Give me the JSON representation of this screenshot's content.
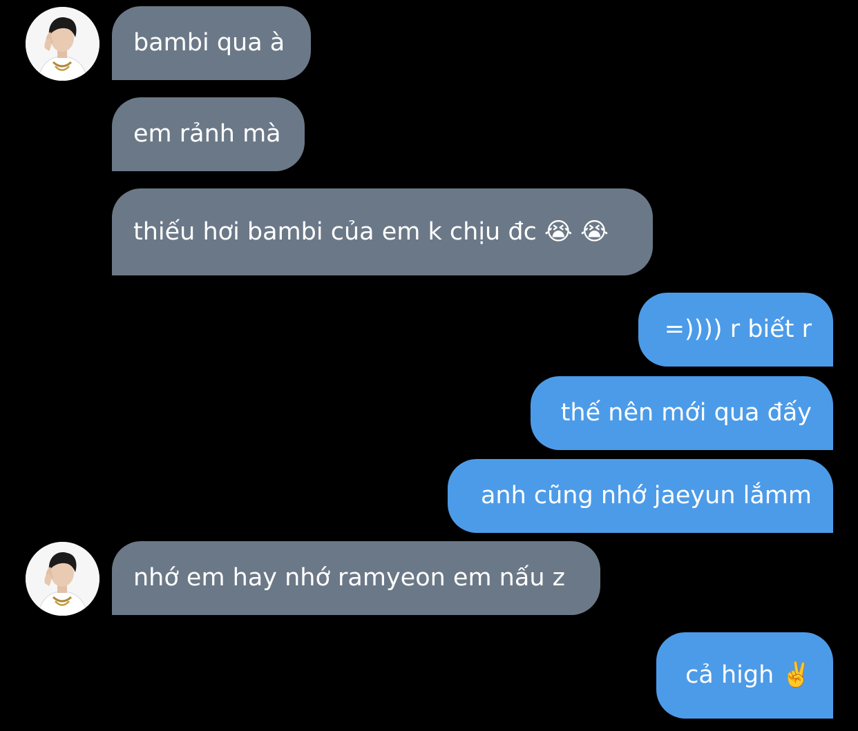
{
  "conversation": {
    "contact_avatar_icon": "person-portrait-avatar",
    "colors": {
      "background": "#000000",
      "incoming_bubble": "#6b7887",
      "outgoing_bubble": "#4c9be8",
      "text": "#ffffff"
    },
    "messages": [
      {
        "direction": "incoming",
        "text": "bambi qua à"
      },
      {
        "direction": "incoming",
        "text": "em rảnh mà"
      },
      {
        "direction": "incoming",
        "text": "thiếu hơi bambi của em k chịu đc 😭 😭"
      },
      {
        "direction": "outgoing",
        "text": "=)))) r biết r"
      },
      {
        "direction": "outgoing",
        "text": "thế nên mới qua đấy"
      },
      {
        "direction": "outgoing",
        "text": "anh cũng nhớ jaeyun lắmm"
      },
      {
        "direction": "incoming",
        "text": "nhớ em hay nhớ ramyeon em nấu z"
      },
      {
        "direction": "outgoing",
        "text": "cả high ✌️"
      }
    ]
  }
}
